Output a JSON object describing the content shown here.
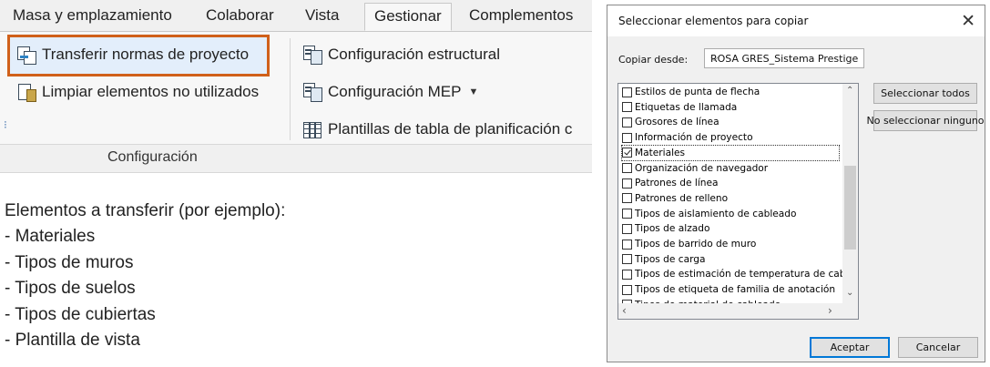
{
  "ribbon": {
    "tabs": [
      "Masa y emplazamiento",
      "Colaborar",
      "Vista",
      "Gestionar",
      "Complementos"
    ],
    "active_tab": "Gestionar",
    "buttons": {
      "transfer": "Transferir normas de proyecto",
      "purge": "Limpiar elementos no utilizados",
      "structural": "Configuración estructural",
      "mep": "Configuración MEP",
      "schedule_templates": "Plantillas de tabla de planificación c"
    },
    "panel_label": "Configuración",
    "highlight_color": "#d0601a"
  },
  "notes": {
    "heading": "Elementos a transferir (por ejemplo):",
    "items": [
      "- Materiales",
      "- Tipos de muros",
      "- Tipos de suelos",
      "- Tipos de cubiertas",
      "- Plantilla de vista"
    ]
  },
  "dialog": {
    "title": "Seleccionar elementos para copiar",
    "copy_from_label": "Copiar desde:",
    "copy_from_value": "ROSA GRES_Sistema Prestige",
    "items": [
      {
        "label": "Estilos de punta de flecha",
        "checked": false
      },
      {
        "label": "Etiquetas de llamada",
        "checked": false
      },
      {
        "label": "Grosores de línea",
        "checked": false
      },
      {
        "label": "Información de proyecto",
        "checked": false
      },
      {
        "label": "Materiales",
        "checked": true
      },
      {
        "label": "Organización de navegador",
        "checked": false
      },
      {
        "label": "Patrones de línea",
        "checked": false
      },
      {
        "label": "Patrones de relleno",
        "checked": false
      },
      {
        "label": "Tipos de aislamiento de cableado",
        "checked": false
      },
      {
        "label": "Tipos de alzado",
        "checked": false
      },
      {
        "label": "Tipos de barrido de muro",
        "checked": false
      },
      {
        "label": "Tipos de carga",
        "checked": false
      },
      {
        "label": "Tipos de estimación de temperatura de cablea",
        "checked": false
      },
      {
        "label": "Tipos de etiqueta de familia de anotación",
        "checked": false
      },
      {
        "label": "Tipos de material de cableado",
        "checked": false
      }
    ],
    "select_all": "Seleccionar todos",
    "select_none": "No seleccionar ninguno",
    "ok": "Aceptar",
    "cancel": "Cancelar"
  }
}
